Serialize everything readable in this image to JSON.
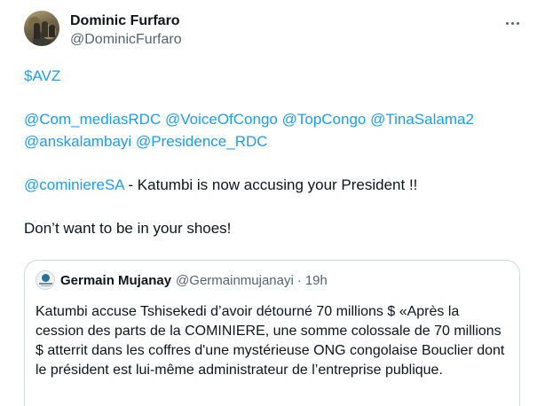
{
  "author": {
    "display_name": "Dominic Furfaro",
    "handle": "@DominicFurfaro"
  },
  "tweet": {
    "cashtag": "$AVZ",
    "mentions_line1": [
      "@Com_mediasRDC",
      "@VoiceOfCongo",
      "@TopCongo",
      "@TinaSalama2"
    ],
    "mentions_line2": [
      "@anskalambayi",
      "@Presidence_RDC"
    ],
    "line3_mention": "@cominiereSA",
    "line3_text": " - Katumbi is now accusing your President !!",
    "line4_text": "Don’t want to be in your shoes!"
  },
  "quoted": {
    "display_name": "Germain Mujanay",
    "handle": "@Germainmujanayi",
    "separator": "·",
    "time": "19h",
    "text": "Katumbi accuse Tshisekedi d’avoir détourné 70 millions $ «Après la cession des parts de la COMINIERE, une somme colossale de 70 millions $ atterrit dans les coffres d'une mystérieuse ONG congolaise Bouclier dont le président est lui-même administrateur de l’entreprise publique."
  },
  "icons": {
    "more": "more-horizontal-icon",
    "link_color": "#1d9bf0"
  }
}
